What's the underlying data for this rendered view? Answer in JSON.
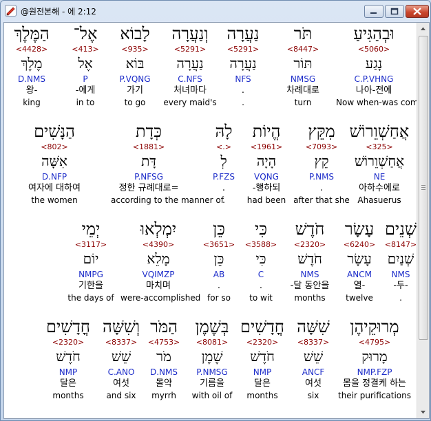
{
  "window": {
    "title": "@원전본해 - 에 2:12"
  },
  "icons": {
    "app": "pencil-app-icon",
    "minimize": "minimize-icon",
    "maximize": "maximize-icon",
    "close": "close-icon"
  },
  "rows": [
    {
      "words": [
        {
          "heb": "וּבְהַגִּיעַ",
          "strong": "<5060>",
          "lex": "נָגַע",
          "morph": "C.P.VHNG",
          "kor": "나아-전에",
          "eng": "Now when-was come"
        },
        {
          "heb": "תֹּר",
          "strong": "<8447>",
          "lex": "תּוֹר",
          "morph": "NMSG",
          "kor": "차례대로",
          "eng": "turn"
        },
        {
          "heb": "נַעֲרָה",
          "strong": "<5291>",
          "lex": "נַעֲרָה",
          "morph": "NFS",
          "kor": ".",
          "eng": "."
        },
        {
          "heb": "וְנַעֲרָה",
          "strong": "<5291>",
          "lex": "נַעֲרָה",
          "morph": "C.NFS",
          "kor": "처녀마다",
          "eng": "every maid's"
        },
        {
          "heb": "לָבוֹא",
          "strong": "<935>",
          "lex": "בּוֹא",
          "morph": "P.VQNG",
          "kor": "가기",
          "eng": "to go"
        },
        {
          "heb": "אֶל־",
          "strong": "<413>",
          "lex": "אֶל",
          "morph": "P",
          "kor": "-에게",
          "eng": "in to"
        },
        {
          "heb": "הַמֶּלֶךְ",
          "strong": "<4428>",
          "lex": "מֶלֶךְ",
          "morph": "D.NMS",
          "kor": "왕-",
          "eng": "king"
        }
      ]
    },
    {
      "words": [
        {
          "heb": "אֲחַשְׁוֵרוֹשׁ",
          "strong": "<325>",
          "lex": "אֲחַשְׁוֵרוֹשׁ",
          "morph": "NE",
          "kor": "아하수에로",
          "eng": "Ahasuerus"
        },
        {
          "heb": "מִקֵּץ",
          "strong": "<7093>",
          "lex": "קֵץ",
          "morph": "P.NMS",
          "kor": ".",
          "eng": "after that she"
        },
        {
          "heb": "הֱיוֹת",
          "strong": "<1961>",
          "lex": "הָיָה",
          "morph": "VQNG",
          "kor": "-행하되",
          "eng": "had been"
        },
        {
          "heb": "לָהּ",
          "strong": "<.>",
          "lex": "לְ",
          "morph": "P.FZS",
          "kor": ".",
          "eng": "."
        },
        {
          "heb": "כְּדָת",
          "strong": "<1881>",
          "lex": "דָּת",
          "morph": "P.NFSG",
          "kor": "정한 규례대로=",
          "eng": "according to the manner of"
        },
        {
          "heb": "הַנָּשִׁים",
          "strong": "<802>",
          "lex": "אִשָּׁה",
          "morph": "D.NFP",
          "kor": "여자에 대하여",
          "eng": "the women"
        }
      ]
    },
    {
      "words": [
        {
          "heb": "שְׁנֵים",
          "strong": "<8147>",
          "lex": "שְׁנַיִם",
          "morph": "NMS",
          "kor": "-두-",
          "eng": "."
        },
        {
          "heb": "עָשָׂר",
          "strong": "<6240>",
          "lex": "עָשָׂר",
          "morph": "ANCM",
          "kor": "열-",
          "eng": "twelve"
        },
        {
          "heb": "חֹדֶשׁ",
          "strong": "<2320>",
          "lex": "חֹדֶשׁ",
          "morph": "NMS",
          "kor": "-달 동안을",
          "eng": "months"
        },
        {
          "heb": "כִּי",
          "strong": "<3588>",
          "lex": "כִּי",
          "morph": "C",
          "kor": ".",
          "eng": "to wit"
        },
        {
          "heb": "כֵּן",
          "strong": "<3651>",
          "lex": "כֵּן",
          "morph": "AB",
          "kor": ".",
          "eng": "for so"
        },
        {
          "heb": "יִמְלְאוּ",
          "strong": "<4390>",
          "lex": "מָלֵא",
          "morph": "VQIMZP",
          "kor": "마치며",
          "eng": "were-accomplished"
        },
        {
          "heb": "יְמֵי",
          "strong": "<3117>",
          "lex": "יוֹם",
          "morph": "NMPG",
          "kor": "기한을",
          "eng": "the days of"
        }
      ]
    },
    {
      "words": [
        {
          "heb": "מְרוּקֵיהֶן",
          "strong": "<4795>",
          "lex": "מָרוּק",
          "morph": "NMP.FZP",
          "kor": "몸을 정결케 하는",
          "eng": "their purifications"
        },
        {
          "heb": "שִׁשָּׁה",
          "strong": "<8337>",
          "lex": "שֵׁשׁ",
          "morph": "ANCF",
          "kor": "여섯",
          "eng": "six"
        },
        {
          "heb": "חֳדָשִׁים",
          "strong": "<2320>",
          "lex": "חֹדֶשׁ",
          "morph": "NMP",
          "kor": "달은",
          "eng": "months"
        },
        {
          "heb": "בְּשֶׁמֶן",
          "strong": "<8081>",
          "lex": "שֶׁמֶן",
          "morph": "P.NMSG",
          "kor": "기름을",
          "eng": "with oil of"
        },
        {
          "heb": "הַמֹּר",
          "strong": "<4753>",
          "lex": "מֹר",
          "morph": "D.NMS",
          "kor": "몰약",
          "eng": "myrrh"
        },
        {
          "heb": "וְשִׁשָּׁה",
          "strong": "<8337>",
          "lex": "שֵׁשׁ",
          "morph": "C.ANO",
          "kor": "여섯",
          "eng": "and six"
        },
        {
          "heb": "חֳדָשִׁים",
          "strong": "<2320>",
          "lex": "חֹדֶשׁ",
          "morph": "NMP",
          "kor": "달은",
          "eng": "months"
        }
      ]
    }
  ]
}
